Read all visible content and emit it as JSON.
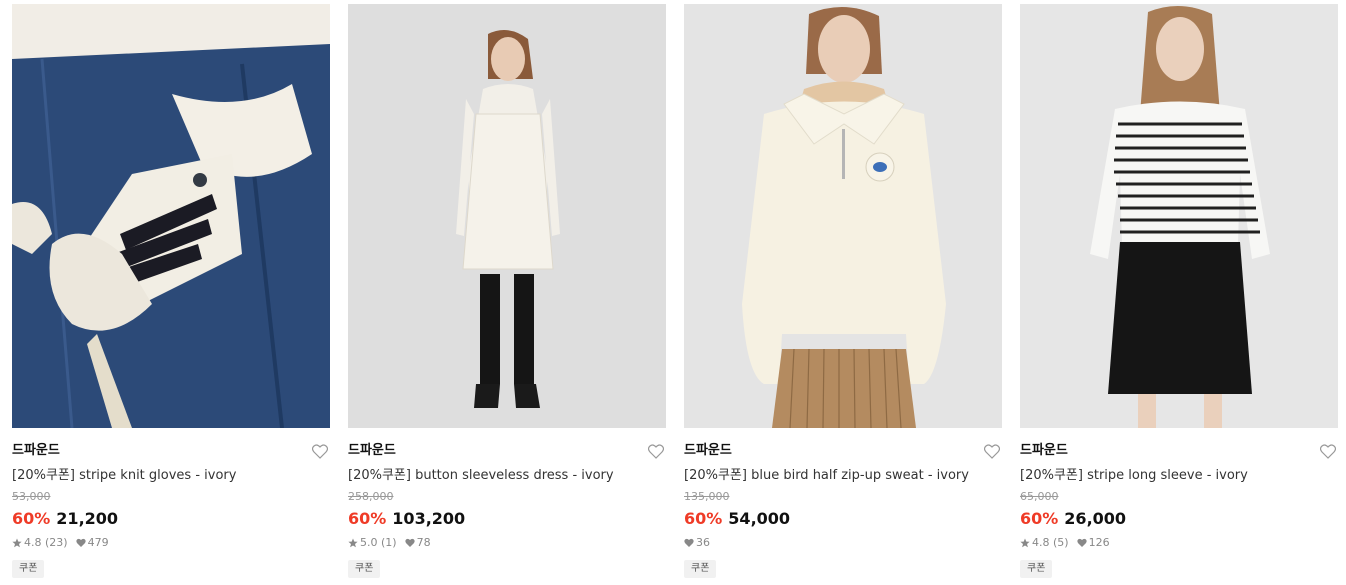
{
  "products": [
    {
      "brand": "드파운드",
      "title": "[20%쿠폰] stripe knit gloves - ivory",
      "original_price": "53,000",
      "discount": "60%",
      "price": "21,200",
      "rating": "4.8",
      "reviews": "(23)",
      "likes": "479",
      "badge": "쿠폰",
      "image_desc": "knit-gloves-photo"
    },
    {
      "brand": "드파운드",
      "title": "[20%쿠폰] button sleeveless dress - ivory",
      "original_price": "258,000",
      "discount": "60%",
      "price": "103,200",
      "rating": "5.0",
      "reviews": "(1)",
      "likes": "78",
      "badge": "쿠폰",
      "image_desc": "sleeveless-dress-photo"
    },
    {
      "brand": "드파운드",
      "title": "[20%쿠폰] blue bird half zip-up sweat - ivory",
      "original_price": "135,000",
      "discount": "60%",
      "price": "54,000",
      "rating": null,
      "reviews": null,
      "likes": "36",
      "badge": "쿠폰",
      "image_desc": "zip-up-sweat-photo"
    },
    {
      "brand": "드파운드",
      "title": "[20%쿠폰] stripe long sleeve - ivory",
      "original_price": "65,000",
      "discount": "60%",
      "price": "26,000",
      "rating": "4.8",
      "reviews": "(5)",
      "likes": "126",
      "badge": "쿠폰",
      "image_desc": "stripe-long-sleeve-photo"
    }
  ],
  "colors": {
    "discount": "#ef3b27",
    "text": "#111111",
    "muted": "#888888"
  }
}
